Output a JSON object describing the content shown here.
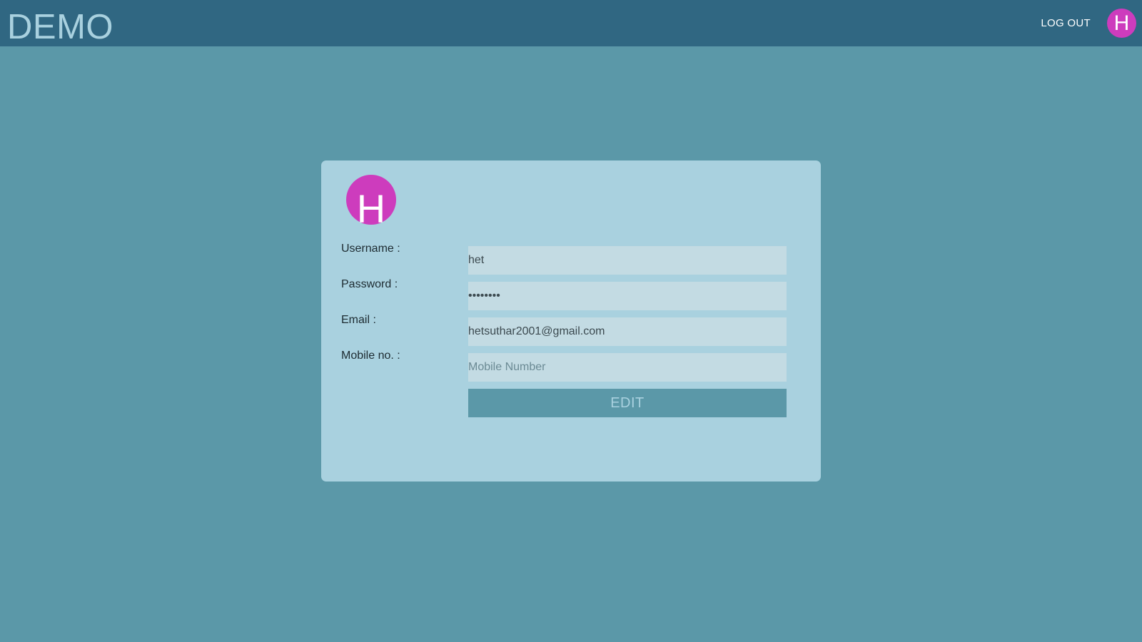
{
  "header": {
    "brand": "DEMO",
    "logout_label": "LOG OUT",
    "avatar_initial": "H"
  },
  "profile": {
    "avatar_initial": "H",
    "fields": {
      "username": {
        "label": "Username :",
        "value": "het"
      },
      "password": {
        "label": "Password :",
        "value": "••••••••"
      },
      "email": {
        "label": "Email :",
        "value": "hetsuthar2001@gmail.com"
      },
      "mobile": {
        "label": "Mobile no. :",
        "value": "",
        "placeholder": "Mobile Number"
      }
    },
    "edit_label": "EDIT"
  },
  "colors": {
    "background": "#5b98a8",
    "header": "#306782",
    "card": "#a9d1df",
    "input": "#c3dbe3",
    "avatar": "#cd3cbd"
  },
  "icons": {
    "top_avatar": "avatar-initial",
    "profile_avatar": "avatar-initial"
  }
}
